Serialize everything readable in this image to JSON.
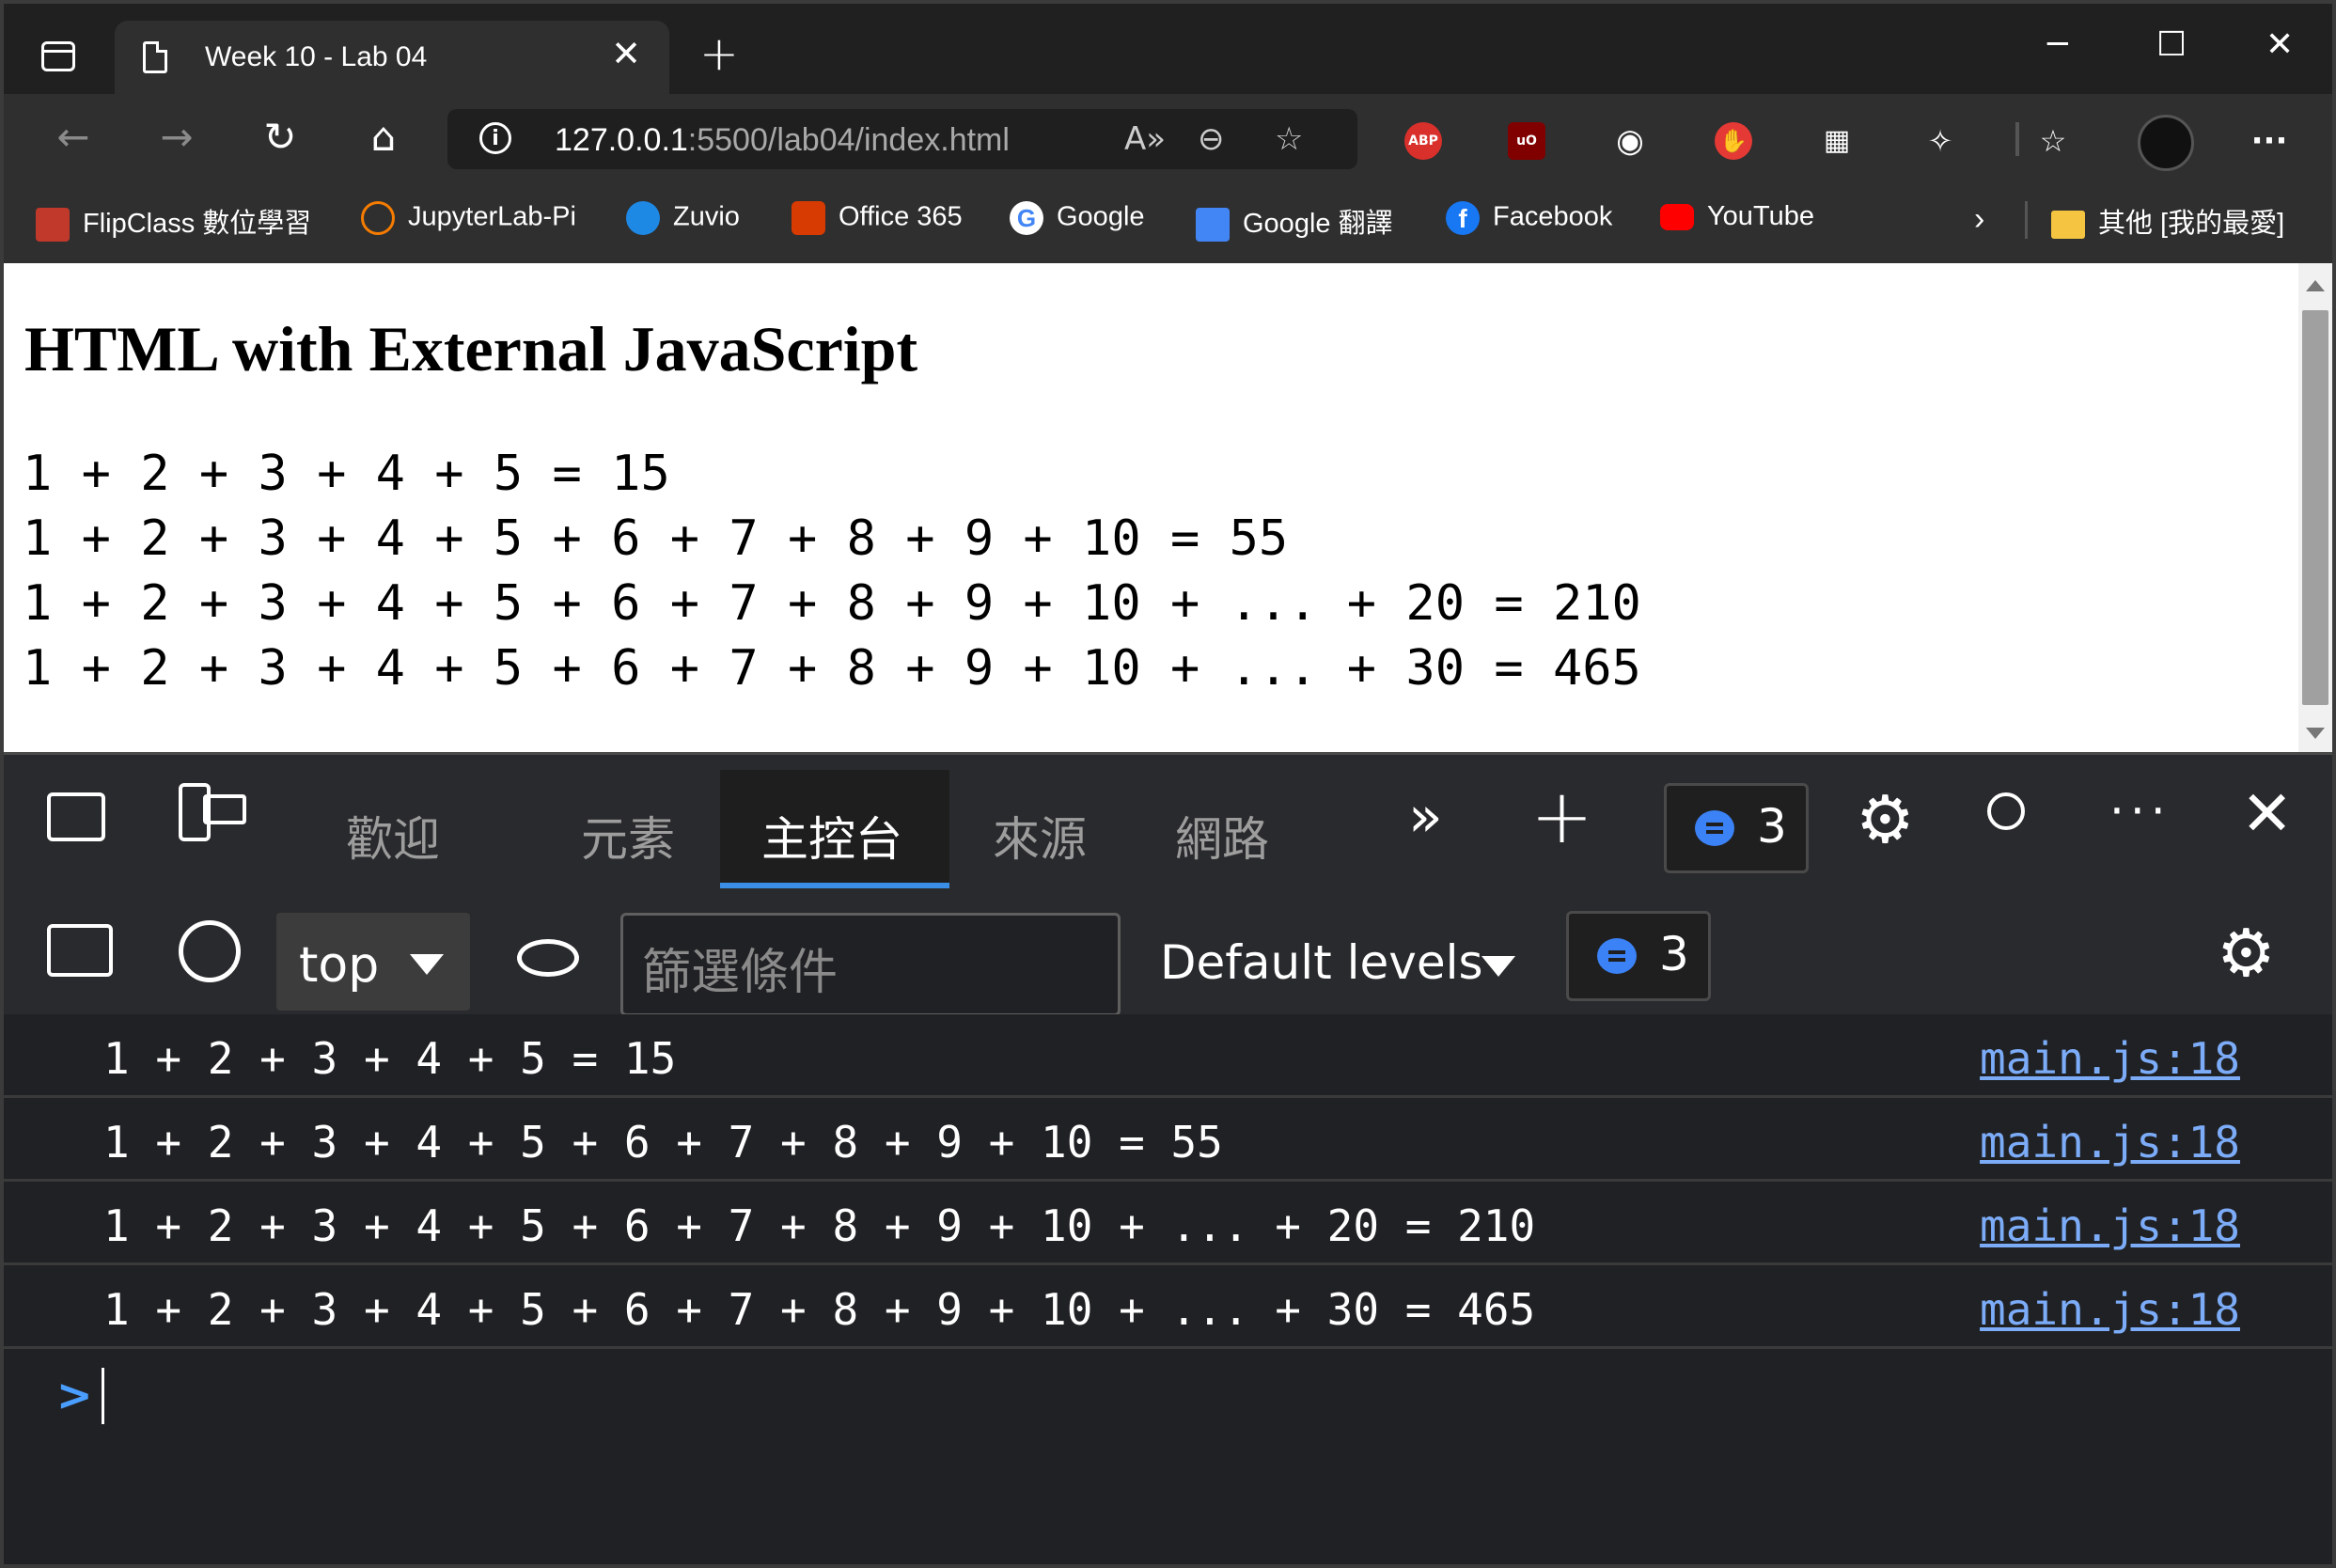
{
  "window": {
    "tab_title": "Week 10 - Lab 04",
    "minimize": "─",
    "maximize": "☐",
    "close": "✕"
  },
  "toolbar": {
    "url_host": "127.0.0.1",
    "url_rest": ":5500/lab04/index.html",
    "ext_abp": "ABP",
    "ext_ublock": "uO"
  },
  "bookmarks": [
    {
      "label": "FlipClass 數位學習",
      "color": "#c0392b"
    },
    {
      "label": "JupyterLab-Pi",
      "color": "#f57c00"
    },
    {
      "label": "Zuvio",
      "color": "#1e88e5"
    },
    {
      "label": "Office 365",
      "color": "#d83b01"
    },
    {
      "label": "Google",
      "color": "#ffffff"
    },
    {
      "label": "Google 翻譯",
      "color": "#4285f4"
    },
    {
      "label": "Facebook",
      "color": "#1877f2"
    },
    {
      "label": "YouTube",
      "color": "#ff0000"
    }
  ],
  "other_bookmarks": "其他 [我的最愛]",
  "page": {
    "heading": "HTML with External JavaScript",
    "lines": [
      "1 + 2 + 3 + 4 + 5 = 15",
      "1 + 2 + 3 + 4 + 5 + 6 + 7 + 8 + 9 + 10 = 55",
      "1 + 2 + 3 + 4 + 5 + 6 + 7 + 8 + 9 + 10 + ... + 20 = 210",
      "1 + 2 + 3 + 4 + 5 + 6 + 7 + 8 + 9 + 10 + ... + 30 = 465"
    ]
  },
  "devtools": {
    "tabs": [
      "歡迎",
      "元素",
      "主控台",
      "來源",
      "網路"
    ],
    "active_tab": "主控台",
    "issues_count": "3",
    "context": "top",
    "filter_placeholder": "篩選條件",
    "levels": "Default levels",
    "messages_count": "3",
    "console_rows": [
      {
        "text": "1 + 2 + 3 + 4 + 5 = 15",
        "source": "main.js:18"
      },
      {
        "text": "1 + 2 + 3 + 4 + 5 + 6 + 7 + 8 + 9 + 10 = 55",
        "source": "main.js:18"
      },
      {
        "text": "1 + 2 + 3 + 4 + 5 + 6 + 7 + 8 + 9 + 10 + ... + 20 = 210",
        "source": "main.js:18"
      },
      {
        "text": "1 + 2 + 3 + 4 + 5 + 6 + 7 + 8 + 9 + 10 + ... + 30 = 465",
        "source": "main.js:18"
      }
    ],
    "prompt": ">"
  },
  "colors": {
    "accent": "#3a8ee6",
    "link": "#7cacf8"
  }
}
